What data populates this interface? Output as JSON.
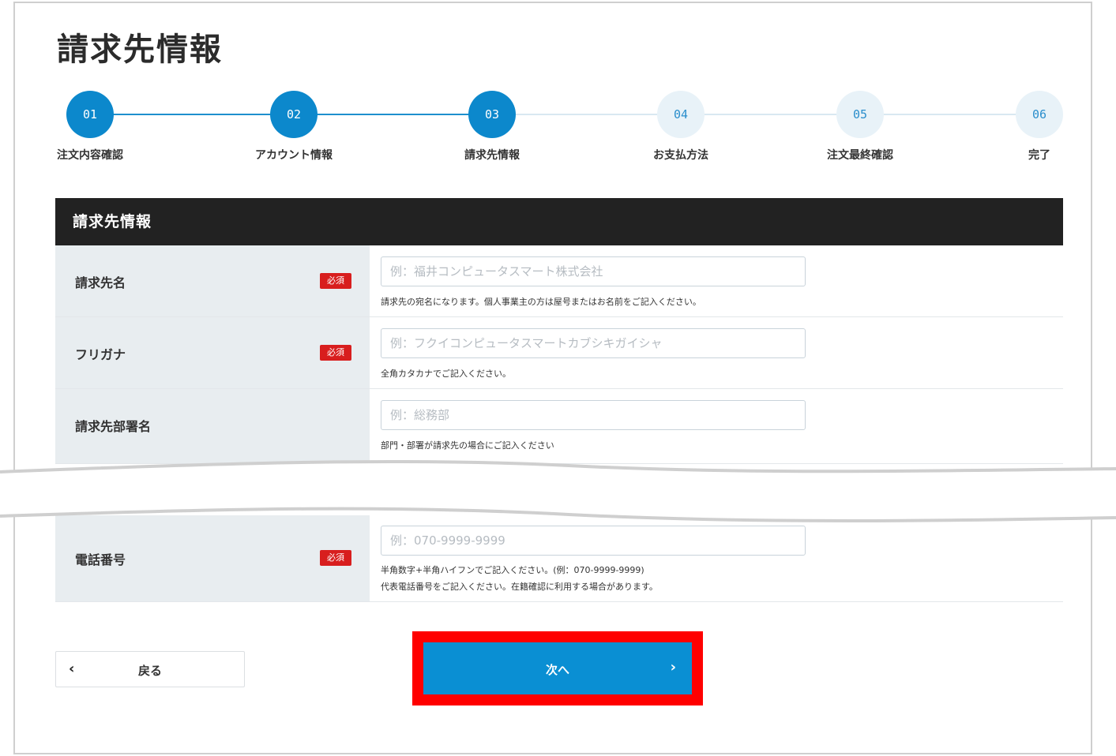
{
  "page": {
    "title": "請求先情報"
  },
  "stepper": {
    "steps": [
      {
        "num": "01",
        "label": "注文内容確認",
        "state": "done"
      },
      {
        "num": "02",
        "label": "アカウント情報",
        "state": "done"
      },
      {
        "num": "03",
        "label": "請求先情報",
        "state": "current"
      },
      {
        "num": "04",
        "label": "お支払方法",
        "state": "todo"
      },
      {
        "num": "05",
        "label": "注文最終確認",
        "state": "todo"
      },
      {
        "num": "06",
        "label": "完了",
        "state": "todo"
      }
    ],
    "done_color": "#0c88cc",
    "todo_color": "#e8f2f8"
  },
  "section": {
    "title": "請求先情報"
  },
  "required_badge": "必須",
  "fields": {
    "billing_name": {
      "label": "請求先名",
      "placeholder": "例：福井コンピュータスマート株式会社",
      "hint": "請求先の宛名になります。個人事業主の方は屋号またはお名前をご記入ください。",
      "required": true
    },
    "furigana": {
      "label": "フリガナ",
      "placeholder": "例：フクイコンピュータスマートカブシキガイシャ",
      "hint": "全角カタカナでご記入ください。",
      "required": true
    },
    "department": {
      "label": "請求先部署名",
      "placeholder": "例：総務部",
      "hint": "部門・部署が請求先の場合にご記入ください",
      "required": false
    },
    "phone": {
      "label": "電話番号",
      "placeholder": "例：070-9999-9999",
      "hint1": "半角数字+半角ハイフンでご記入ください。(例：070-9999-9999)",
      "hint2": "代表電話番号をご記入ください。在籍確認に利用する場合があります。",
      "required": true
    }
  },
  "buttons": {
    "back_label": "戻る",
    "next_label": "次へ",
    "next_color": "#0a8fd3",
    "highlight_color": "#ff0000"
  }
}
